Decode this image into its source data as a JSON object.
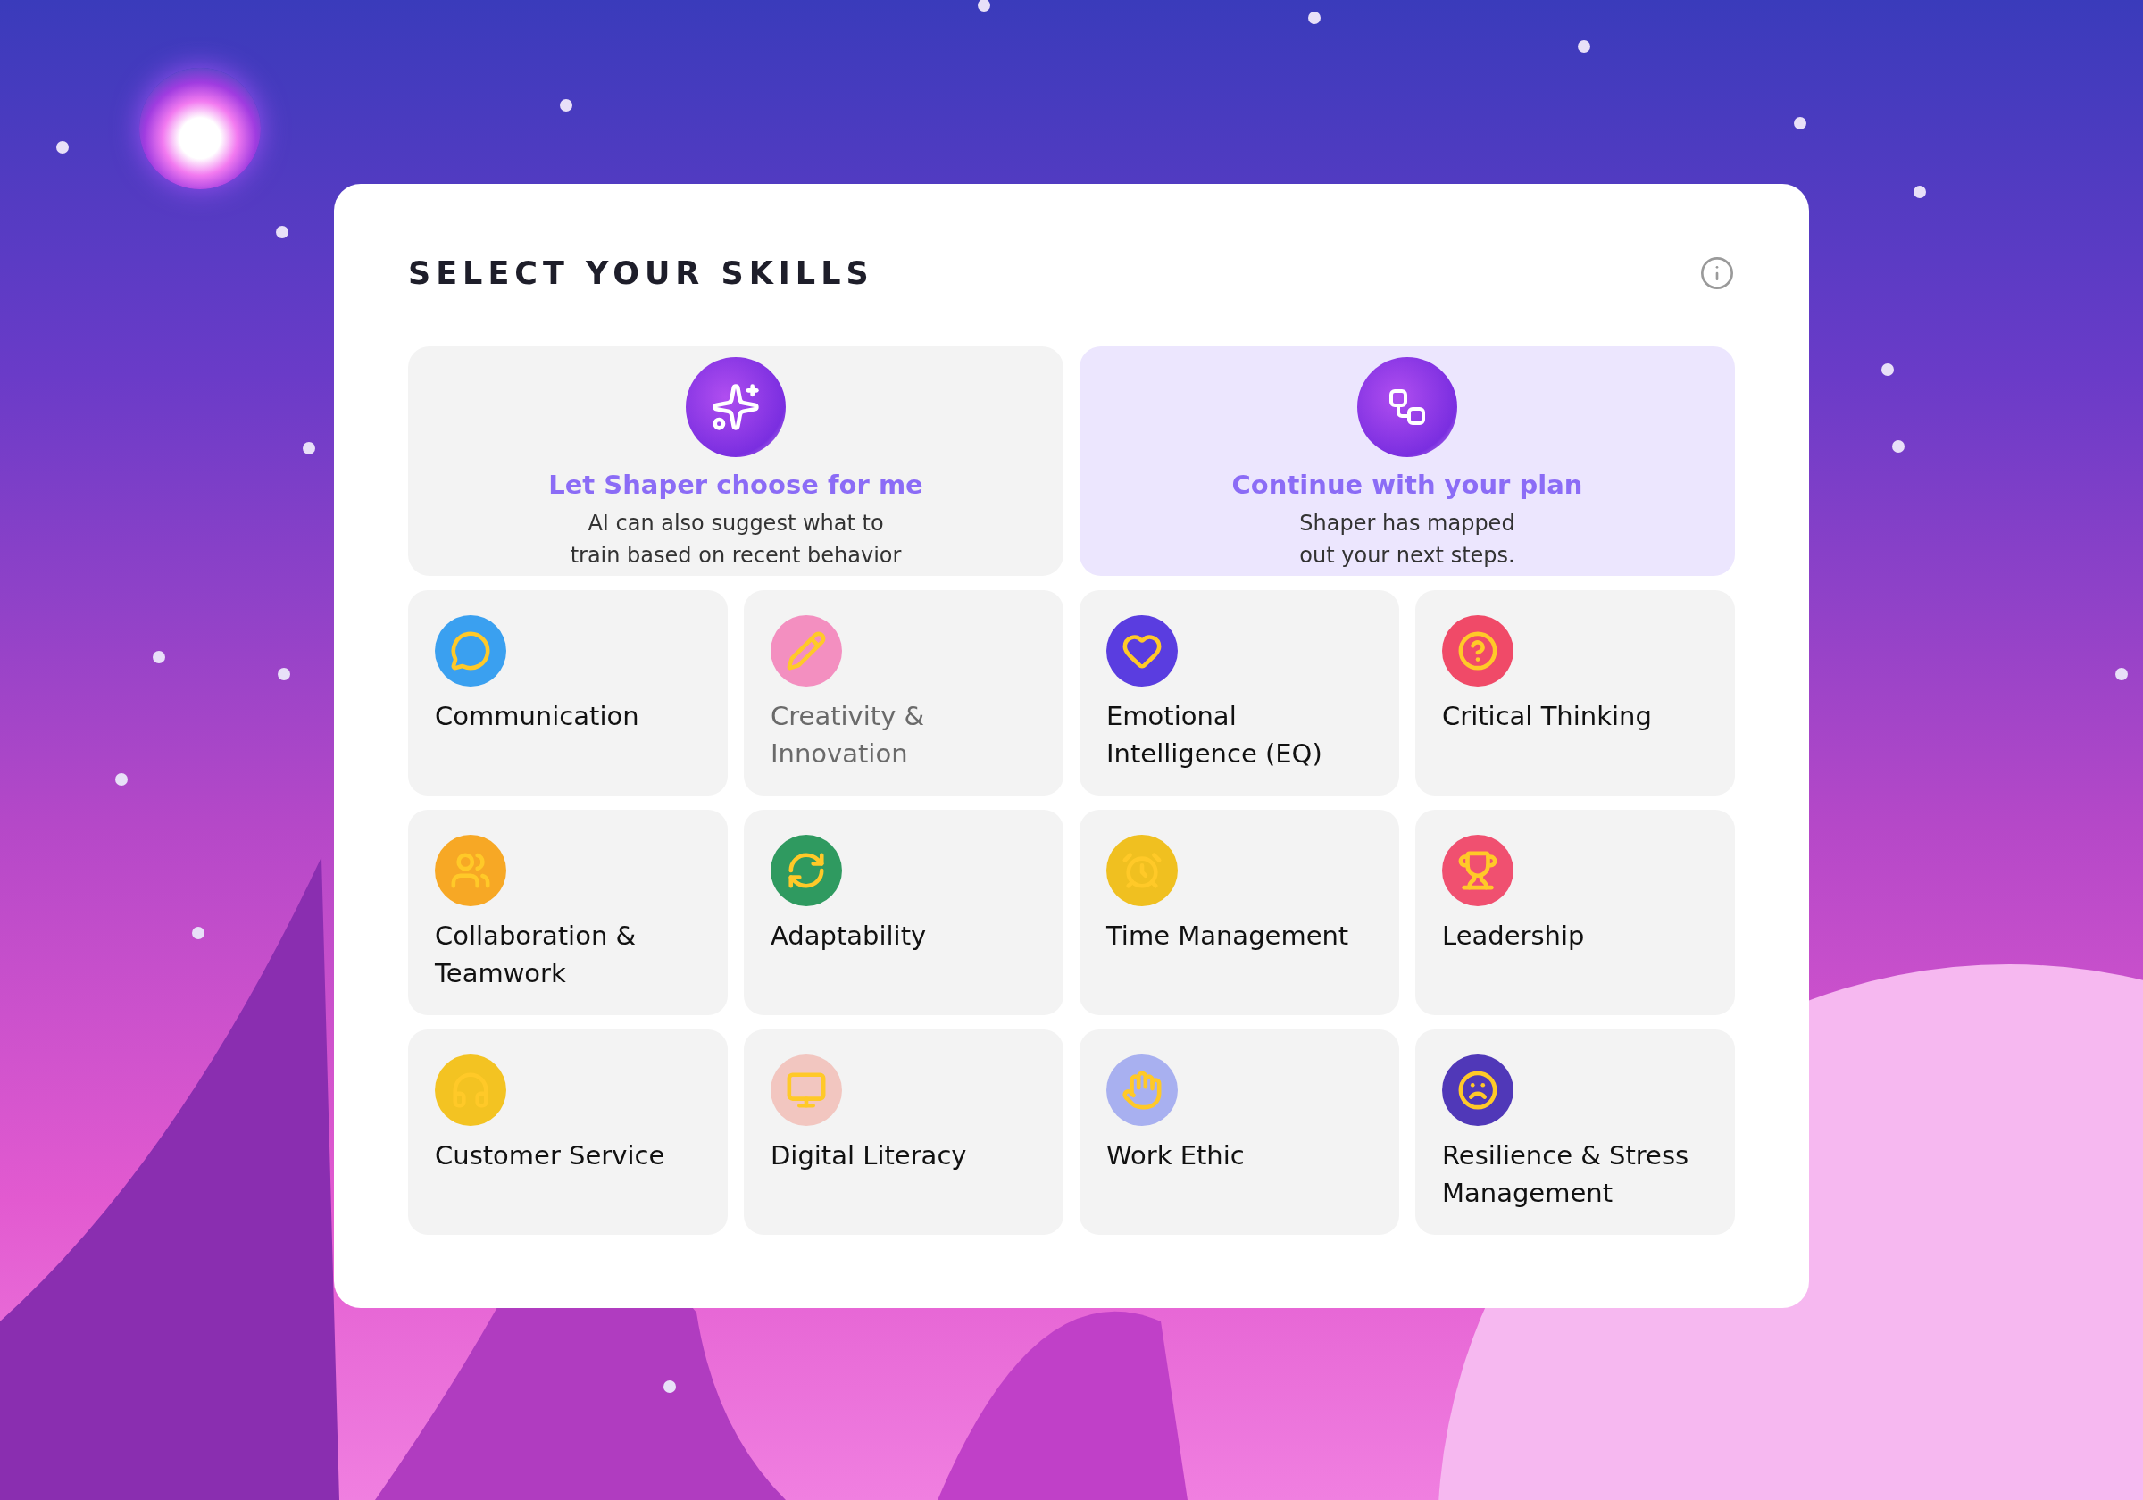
{
  "title": "SELECT YOUR SKILLS",
  "options": [
    {
      "title": "Let Shaper choose for me",
      "lines": [
        "AI can also suggest what to",
        "train based on recent behavior"
      ],
      "selected": false
    },
    {
      "title": "Continue with your plan",
      "lines": [
        "Shaper has mapped",
        "out your next steps."
      ],
      "selected": true
    }
  ],
  "skills": [
    {
      "label": "Communication",
      "disabled": false
    },
    {
      "label": "Creativity & Innovation",
      "disabled": true
    },
    {
      "label": "Emotional Intelligence (EQ)",
      "disabled": false
    },
    {
      "label": "Critical Thinking",
      "disabled": false
    },
    {
      "label": "Collaboration & Teamwork",
      "disabled": false
    },
    {
      "label": "Adaptability",
      "disabled": false
    },
    {
      "label": "Time Management",
      "disabled": false
    },
    {
      "label": "Leadership",
      "disabled": false
    },
    {
      "label": "Customer Service",
      "disabled": false
    },
    {
      "label": "Digital Literacy",
      "disabled": false
    },
    {
      "label": "Work Ethic",
      "disabled": false
    },
    {
      "label": "Resilience & Stress Management",
      "disabled": false
    }
  ]
}
